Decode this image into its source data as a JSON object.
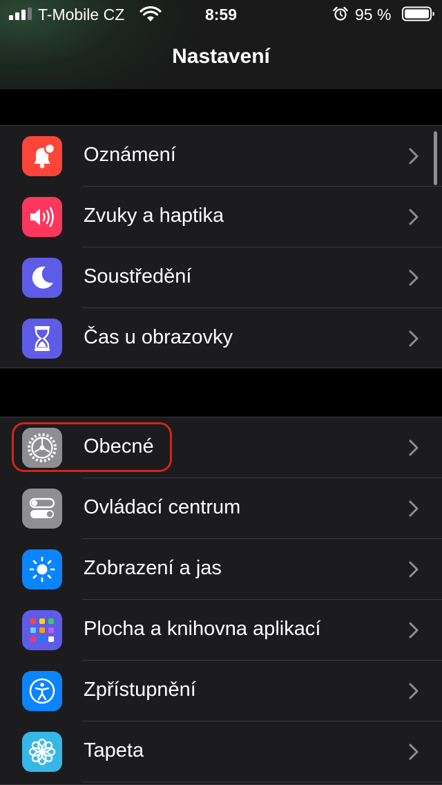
{
  "status": {
    "carrier": "T-Mobile CZ",
    "time": "8:59",
    "battery_percent": "95 %"
  },
  "header": {
    "title": "Nastavení"
  },
  "groups": [
    {
      "items": [
        {
          "label": "Oznámení",
          "icon": "bell-badge-icon",
          "color": "#fe453a"
        },
        {
          "label": "Zvuky a haptika",
          "icon": "speaker-icon",
          "color": "#fe375f"
        },
        {
          "label": "Soustředění",
          "icon": "moon-icon",
          "color": "#5e5ce6"
        },
        {
          "label": "Čas u obrazovky",
          "icon": "hourglass-icon",
          "color": "#5e5ce6"
        }
      ]
    },
    {
      "items": [
        {
          "label": "Obecné",
          "icon": "gear-icon",
          "color": "#8e8e93",
          "highlighted": true
        },
        {
          "label": "Ovládací centrum",
          "icon": "toggles-icon",
          "color": "#8e8e93"
        },
        {
          "label": "Zobrazení a jas",
          "icon": "sun-icon",
          "color": "#0a84ff"
        },
        {
          "label": "Plocha a knihovna aplikací",
          "icon": "app-grid-icon",
          "color": "#5e5ce6"
        },
        {
          "label": "Zpřístupnění",
          "icon": "accessibility-icon",
          "color": "#0a84ff"
        },
        {
          "label": "Tapeta",
          "icon": "flower-icon",
          "color": "#35b8e6"
        }
      ]
    }
  ]
}
